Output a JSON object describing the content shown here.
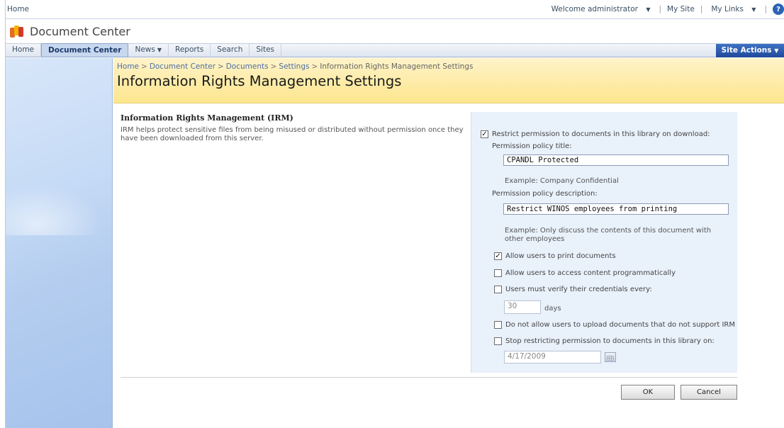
{
  "topbar": {
    "home": "Home",
    "welcome": "Welcome administrator",
    "my_site": "My Site",
    "my_links": "My Links",
    "sep": "|",
    "help_icon": "help-icon"
  },
  "site": {
    "title": "Document Center"
  },
  "nav": {
    "home": "Home",
    "document_center": "Document Center",
    "news": "News",
    "reports": "Reports",
    "search": "Search",
    "sites": "Sites",
    "site_actions": "Site Actions",
    "dropdown_glyph": "▼"
  },
  "breadcrumb": [
    "Home",
    "Document Center",
    "Documents",
    "Settings",
    "Information Rights Management Settings"
  ],
  "breadcrumb_sep": ">",
  "page_title": "Information Rights Management Settings",
  "section": {
    "title": "Information Rights Management (IRM)",
    "description": "IRM helps protect sensitive files from being misused or distributed without permission once they have been downloaded from this server."
  },
  "form": {
    "restrict_label": "Restrict permission to documents in this library on download:",
    "restrict_checked": true,
    "policy_title_label": "Permission policy title:",
    "policy_title_value": "CPANDL Protected",
    "policy_title_example": "Example: Company Confidential",
    "policy_desc_label": "Permission policy description:",
    "policy_desc_value": "Restrict WINOS employees from printing",
    "policy_desc_example": "Example: Only discuss the contents of this document with other employees",
    "allow_print_label": "Allow users to print documents",
    "allow_print_checked": true,
    "allow_programmatic_label": "Allow users to access content programmatically",
    "verify_label": "Users must verify their credentials every:",
    "verify_days_value": "30",
    "days_label": "days",
    "no_upload_label": "Do not allow users to upload documents that do not support IRM",
    "stop_label": "Stop restricting permission to documents in this library on:",
    "stop_date_value": "4/17/2009",
    "calendar_icon": "calendar-icon",
    "check_glyph": "✓"
  },
  "buttons": {
    "ok": "OK",
    "cancel": "Cancel"
  }
}
